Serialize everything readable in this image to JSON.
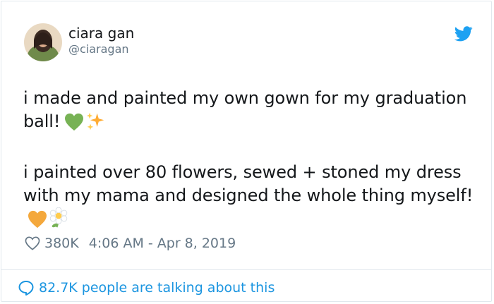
{
  "tweet": {
    "author_name": "ciara gan",
    "author_handle": "@ciaragan",
    "paragraph1": "i made and painted my own gown for my graduation ball!",
    "paragraph2": "i painted over 80 flowers, sewed + stoned my dress with my mama and designed the whole thing myself!",
    "likes": "380K",
    "timestamp": "4:06 AM - Apr 8, 2019",
    "conversation": "82.7K people are talking about this"
  },
  "icons": {
    "brand": "twitter-bird-icon",
    "like": "heart-outline-icon",
    "reply": "speech-bubble-icon",
    "emoji1": "green-heart-emoji",
    "emoji2": "sparkles-emoji",
    "emoji3": "orange-heart-emoji",
    "emoji4": "blossom-emoji"
  },
  "colors": {
    "twitter_blue": "#1da1f2",
    "link_blue": "#1b95e0",
    "secondary_text": "#657786",
    "border": "#e1e8ed"
  }
}
